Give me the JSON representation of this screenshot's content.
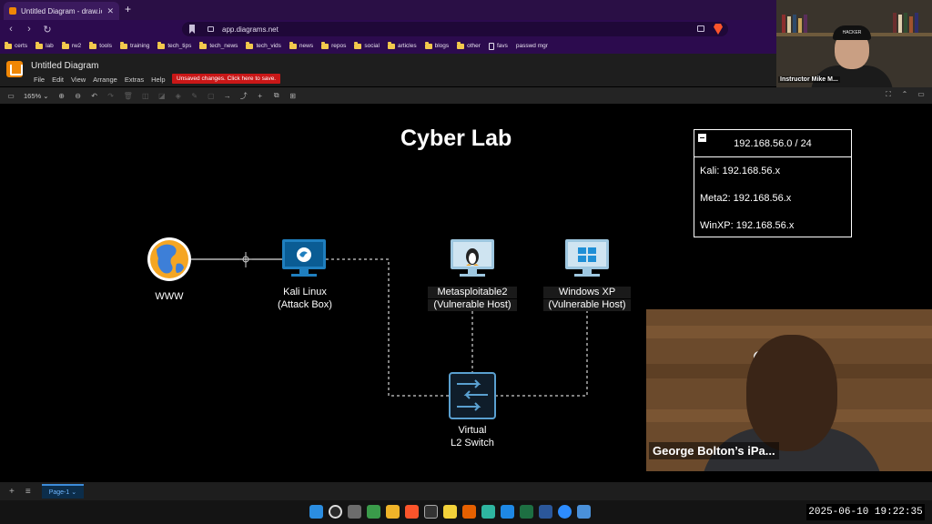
{
  "browser": {
    "tab_title": "Untitled Diagram - draw.io",
    "tab_close": "✕",
    "new_tab": "+",
    "url": "app.diagrams.net",
    "bookmarks": [
      "certs",
      "lab",
      "rw2",
      "tools",
      "training",
      "tech_tips",
      "tech_news",
      "tech_vids",
      "news",
      "repos",
      "social",
      "articles",
      "blogs",
      "other",
      "favs",
      "passwd mgr"
    ]
  },
  "app": {
    "doc_title": "Untitled Diagram",
    "menus": [
      "File",
      "Edit",
      "View",
      "Arrange",
      "Extras",
      "Help"
    ],
    "unsaved_notice": "Unsaved changes. Click here to save.",
    "zoom": "165%"
  },
  "presenter": {
    "name": "Instructor Mike M...",
    "cap_text": "HACKER"
  },
  "diagram": {
    "title": "Cyber Lab",
    "nodes": {
      "www": "WWW",
      "kali_line1": "Kali Linux",
      "kali_line2": "(Attack Box)",
      "meta_line1": "Metasploitable2",
      "meta_line2": "(Vulnerable Host)",
      "winxp_line1": "Windows XP",
      "winxp_line2": "(Vulnerable Host)",
      "switch_line1": "Virtual",
      "switch_line2": "L2 Switch"
    },
    "network_box": {
      "header": "192.168.56.0 / 24",
      "rows": [
        "Kali:  192.168.56.x",
        "Meta2:  192.168.56.x",
        "WinXP:  192.168.56.x"
      ]
    }
  },
  "participant": {
    "name": "George Bolton’s iPa..."
  },
  "pagebar": {
    "page_tab": "Page-1 ⌄",
    "add": "+",
    "menu": "≡"
  },
  "taskbar": {
    "clock": "2025-06-10  19:22:35"
  }
}
